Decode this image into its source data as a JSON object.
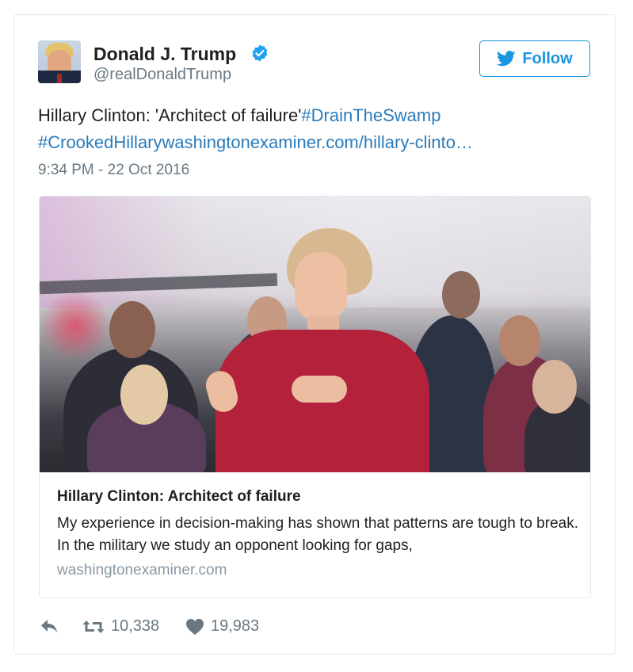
{
  "tweet": {
    "author_name": "Donald J. Trump",
    "author_handle": "@realDonaldTrump",
    "follow_label": "Follow",
    "text_plain": "Hillary Clinton: 'Architect of failure'",
    "hashtag_drain": "#DrainTheSwamp",
    "hashtag_crooked": "#CrookedHillary",
    "link_text": "washingtonexaminer.com/hillary-clinto…",
    "timestamp": "9:34 PM - 22 Oct 2016"
  },
  "card": {
    "title": "Hillary Clinton: Architect of failure",
    "description": "My experience in decision-making has shown that patterns are tough to break. In the military we study an opponent looking for gaps,",
    "domain": "washingtonexaminer.com"
  },
  "actions": {
    "retweet_count": "10,338",
    "like_count": "19,983"
  },
  "icons": {
    "verified": "verified-badge-icon",
    "follow": "twitter-bird-icon",
    "reply": "reply-icon",
    "retweet": "retweet-icon",
    "like": "heart-icon"
  },
  "colors": {
    "link": "#2b7bb9",
    "follow_blue": "#1b95e0",
    "muted": "#697882"
  }
}
